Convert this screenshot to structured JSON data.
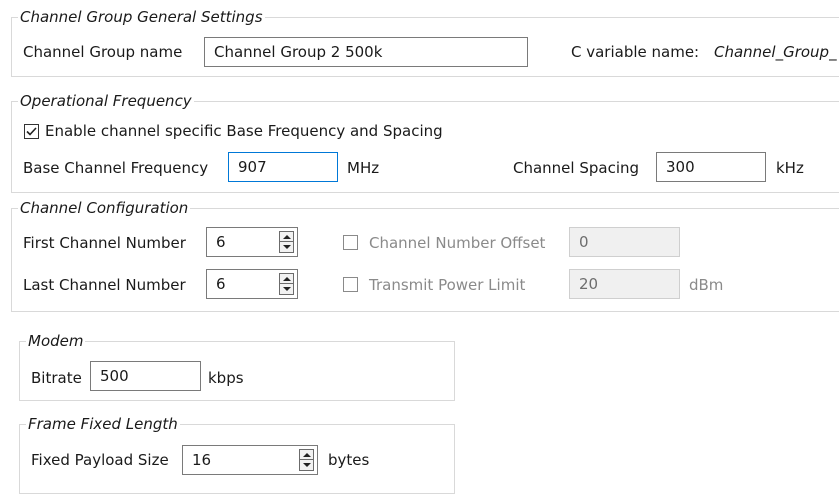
{
  "general": {
    "title": "Channel Group General Settings",
    "name_label": "Channel Group name",
    "name_value": "Channel Group 2 500k",
    "c_var_label": "C variable name:",
    "c_var_value": "Channel_Group_"
  },
  "operational": {
    "title": "Operational Frequency",
    "enable_label": "Enable channel specific Base Frequency and Spacing",
    "enable_checked": true,
    "base_label": "Base Channel Frequency",
    "base_value": "907",
    "base_unit": "MHz",
    "spacing_label": "Channel Spacing",
    "spacing_value": "300",
    "spacing_unit": "kHz"
  },
  "channel_config": {
    "title": "Channel Configuration",
    "first_label": "First Channel Number",
    "first_value": "6",
    "last_label": "Last Channel Number",
    "last_value": "6",
    "offset_label": "Channel Number Offset",
    "offset_checked": false,
    "offset_value": "0",
    "power_label": "Transmit Power Limit",
    "power_checked": false,
    "power_value": "20",
    "power_unit": "dBm"
  },
  "modem": {
    "title": "Modem",
    "bitrate_label": "Bitrate",
    "bitrate_value": "500",
    "bitrate_unit": "kbps"
  },
  "frame": {
    "title": "Frame Fixed Length",
    "payload_label": "Fixed Payload Size",
    "payload_value": "16",
    "payload_unit": "bytes"
  },
  "colors": {
    "focus_border": "#0078d7",
    "group_border": "#d9d9d9",
    "disabled_text": "#8a8a8a"
  }
}
